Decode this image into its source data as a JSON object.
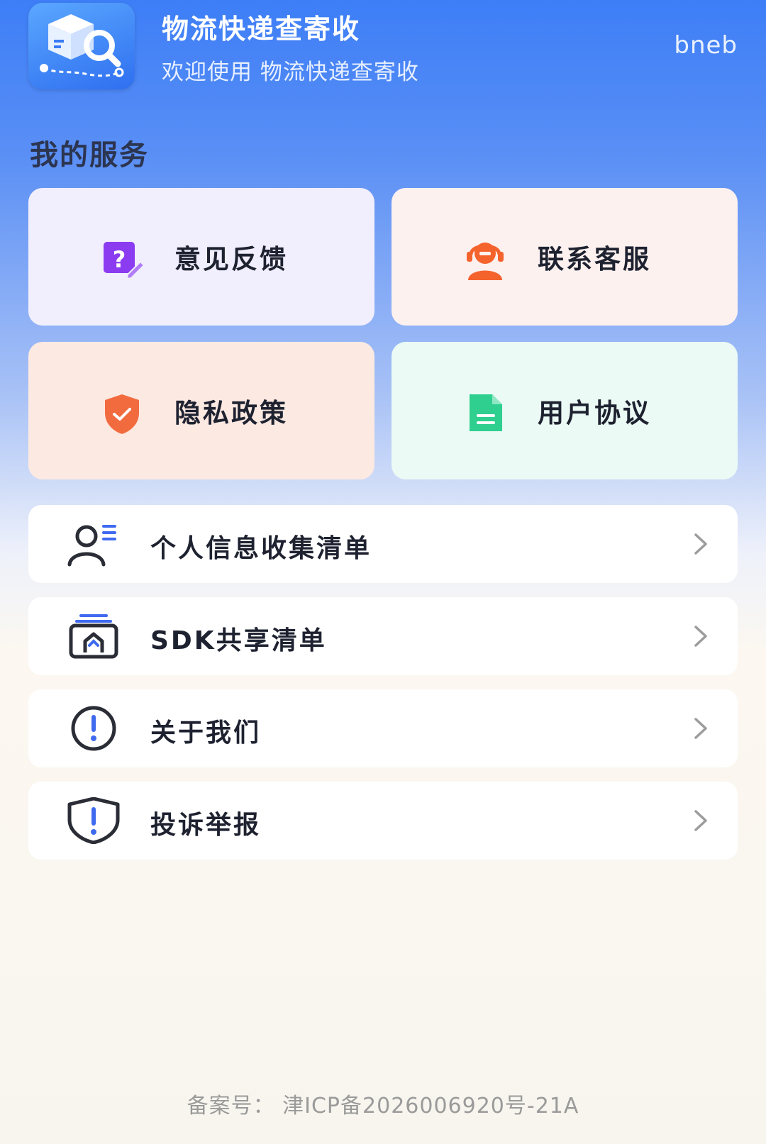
{
  "header": {
    "app_title": "物流快递查寄收",
    "subtitle": "欢迎使用 物流快递查寄收",
    "username": "bneb"
  },
  "services": {
    "title": "我的服务",
    "cards": [
      {
        "label": "意见反馈",
        "icon": "feedback-icon",
        "color": "#8b3cf0"
      },
      {
        "label": "联系客服",
        "icon": "customer-service-icon",
        "color": "#f5632d"
      },
      {
        "label": "隐私政策",
        "icon": "privacy-shield-icon",
        "color": "#f26b3f"
      },
      {
        "label": "用户协议",
        "icon": "document-icon",
        "color": "#2fcf8f"
      }
    ]
  },
  "list": [
    {
      "label": "个人信息收集清单",
      "icon": "person-list-icon"
    },
    {
      "label": "SDK共享清单",
      "icon": "sdk-share-icon"
    },
    {
      "label": "关于我们",
      "icon": "info-circle-icon"
    },
    {
      "label": "投诉举报",
      "icon": "report-shield-icon"
    }
  ],
  "footer": {
    "icp": "备案号： 津ICP备2026006920号-21A"
  },
  "colors": {
    "header_blue": "#3d7ef7",
    "accent_blue": "#2f6ff0"
  }
}
